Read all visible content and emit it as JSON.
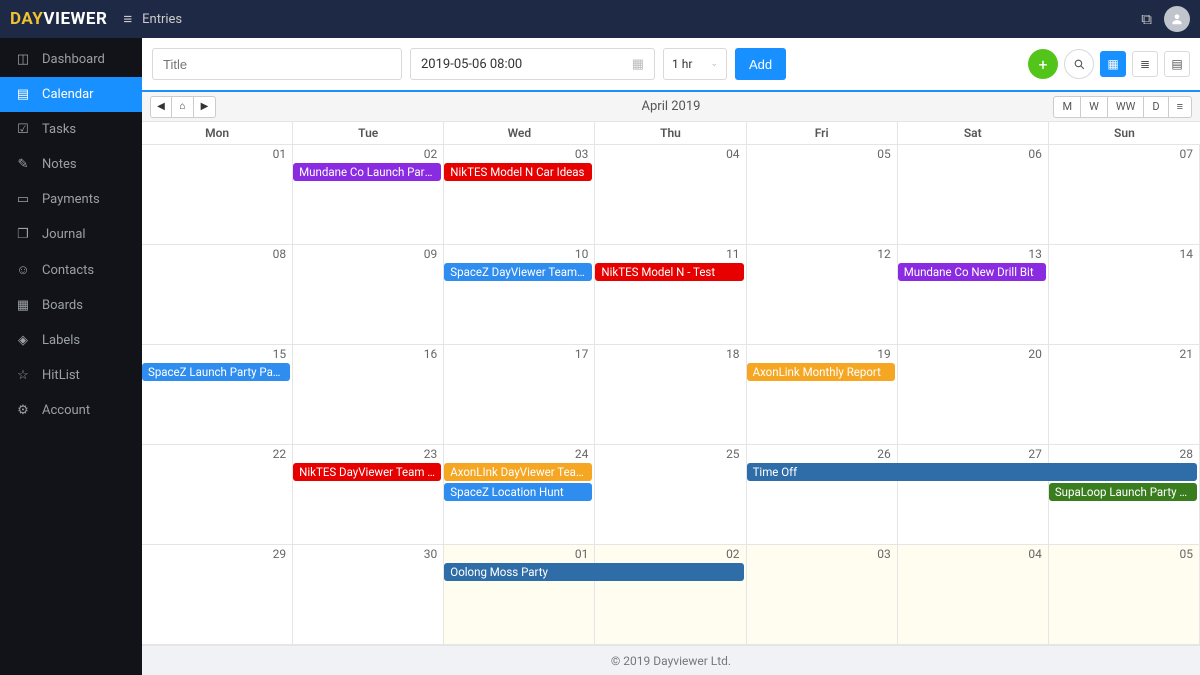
{
  "topbar": {
    "logo_day": "DAY",
    "logo_viewer": "VIEWER",
    "section": "Entries"
  },
  "sidebar": {
    "items": [
      {
        "label": "Dashboard",
        "icon": "◫"
      },
      {
        "label": "Calendar",
        "icon": "▤"
      },
      {
        "label": "Tasks",
        "icon": "☑"
      },
      {
        "label": "Notes",
        "icon": "✎"
      },
      {
        "label": "Payments",
        "icon": "▭"
      },
      {
        "label": "Journal",
        "icon": "❐"
      },
      {
        "label": "Contacts",
        "icon": "☺"
      },
      {
        "label": "Boards",
        "icon": "▦"
      },
      {
        "label": "Labels",
        "icon": "◈"
      },
      {
        "label": "HitList",
        "icon": "☆"
      },
      {
        "label": "Account",
        "icon": "⚙"
      }
    ],
    "active_index": 1
  },
  "toolbar": {
    "title_placeholder": "Title",
    "date_value": "2019-05-06 08:00",
    "duration": "1 hr",
    "add_label": "Add"
  },
  "calendar": {
    "title": "April 2019",
    "views": [
      "M",
      "W",
      "WW",
      "D",
      "≡"
    ],
    "day_headers": [
      "Mon",
      "Tue",
      "Wed",
      "Thu",
      "Fri",
      "Sat",
      "Sun"
    ],
    "weeks": [
      {
        "days": [
          "01",
          "02",
          "03",
          "04",
          "05",
          "06",
          "07"
        ],
        "other": [
          0,
          0,
          0,
          0,
          0,
          0,
          0
        ]
      },
      {
        "days": [
          "08",
          "09",
          "10",
          "11",
          "12",
          "13",
          "14"
        ],
        "other": [
          0,
          0,
          0,
          0,
          0,
          0,
          0
        ]
      },
      {
        "days": [
          "15",
          "16",
          "17",
          "18",
          "19",
          "20",
          "21"
        ],
        "other": [
          0,
          0,
          0,
          0,
          0,
          0,
          0
        ]
      },
      {
        "days": [
          "22",
          "23",
          "24",
          "25",
          "26",
          "27",
          "28"
        ],
        "other": [
          0,
          0,
          0,
          0,
          0,
          0,
          0
        ]
      },
      {
        "days": [
          "29",
          "30",
          "01",
          "02",
          "03",
          "04",
          "05"
        ],
        "other": [
          0,
          0,
          1,
          1,
          1,
          1,
          1
        ]
      }
    ],
    "events": [
      {
        "week": 0,
        "row": 0,
        "col": 1,
        "span": 1,
        "color": "#8a2be2",
        "label": "Mundane Co Launch Party …"
      },
      {
        "week": 0,
        "row": 0,
        "col": 2,
        "span": 1,
        "color": "#e60000",
        "label": "NikTES Model N Car Ideas"
      },
      {
        "week": 1,
        "row": 0,
        "col": 2,
        "span": 1,
        "color": "#2f8df0",
        "label": "SpaceZ DayViewer Team Ro…"
      },
      {
        "week": 1,
        "row": 0,
        "col": 3,
        "span": 1,
        "color": "#e60000",
        "label": "NikTES Model N - Test"
      },
      {
        "week": 1,
        "row": 0,
        "col": 5,
        "span": 1,
        "color": "#8a2be2",
        "label": "Mundane Co New Drill Bit"
      },
      {
        "week": 2,
        "row": 0,
        "col": 0,
        "span": 1,
        "color": "#2f8df0",
        "label": "SpaceZ Launch Party Paym…"
      },
      {
        "week": 2,
        "row": 0,
        "col": 4,
        "span": 1,
        "color": "#f5a623",
        "label": "AxonLink Monthly Report"
      },
      {
        "week": 3,
        "row": 0,
        "col": 1,
        "span": 1,
        "color": "#e60000",
        "label": "NikTES DayViewer Team Room"
      },
      {
        "week": 3,
        "row": 0,
        "col": 2,
        "span": 1,
        "color": "#f5a623",
        "label": "AxonLInk DayViewer Team …"
      },
      {
        "week": 3,
        "row": 0,
        "col": 4,
        "span": 3,
        "color": "#2f6da8",
        "label": "Time Off"
      },
      {
        "week": 3,
        "row": 1,
        "col": 2,
        "span": 1,
        "color": "#2f8df0",
        "label": "SpaceZ Location Hunt"
      },
      {
        "week": 3,
        "row": 1,
        "col": 6,
        "span": 1,
        "color": "#3a7d1f",
        "label": "SupaLoop Launch Party Pa…"
      },
      {
        "week": 4,
        "row": 0,
        "col": 2,
        "span": 2,
        "color": "#2f6da8",
        "label": "Oolong Moss Party"
      }
    ]
  },
  "footer": {
    "copyright": "© 2019 Dayviewer Ltd."
  }
}
